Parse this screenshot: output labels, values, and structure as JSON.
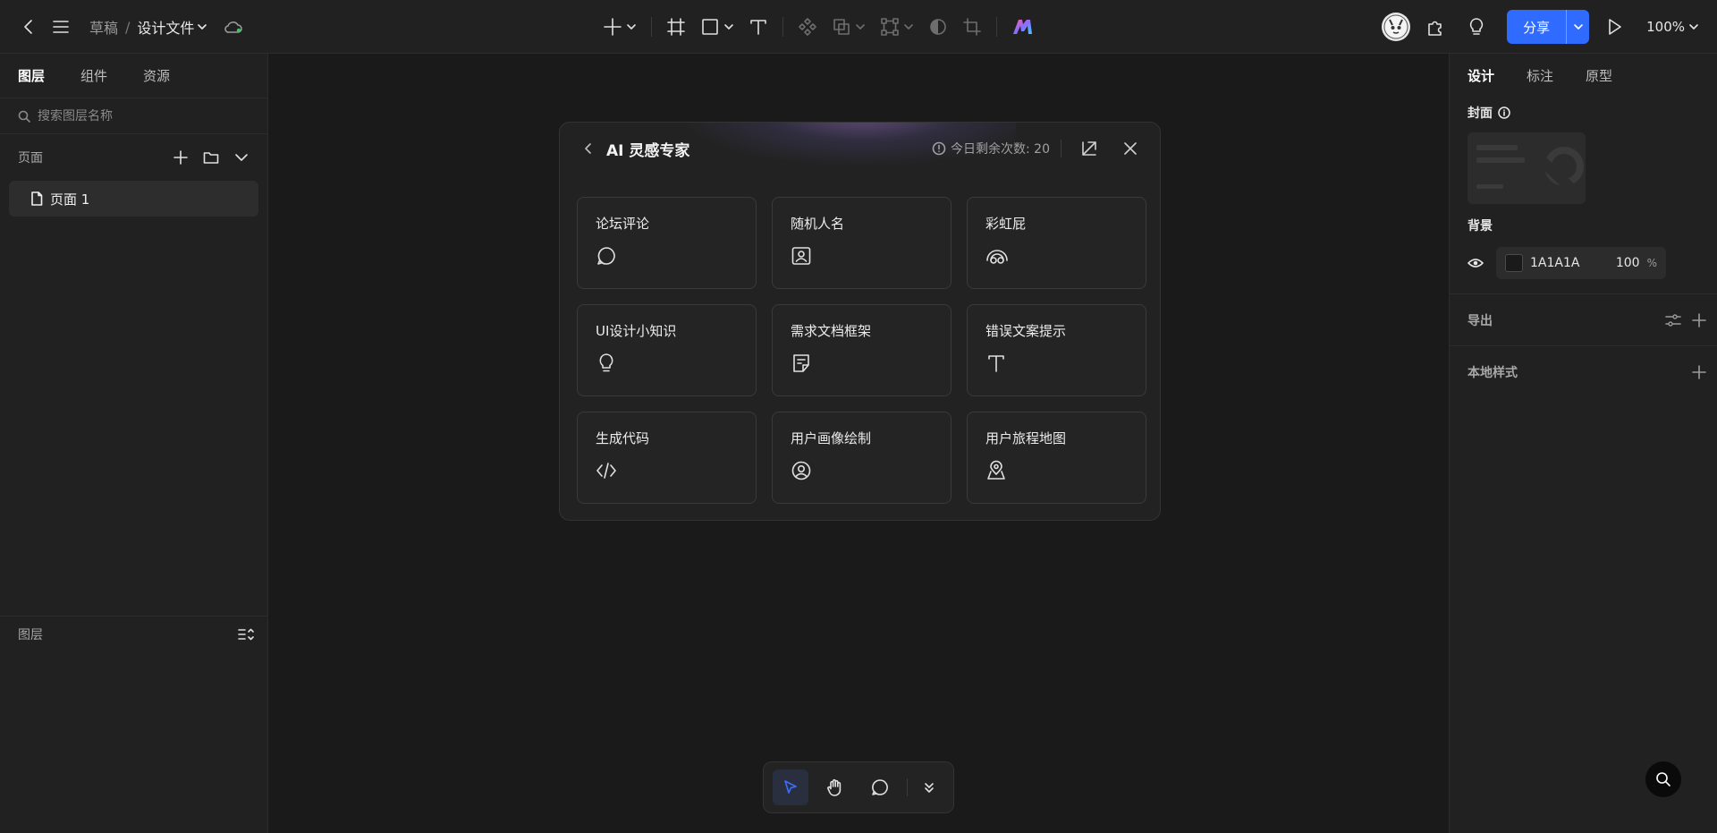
{
  "topbar": {
    "breadcrumb_root": "草稿",
    "breadcrumb_sep": "/",
    "file_name": "设计文件",
    "share_label": "分享",
    "zoom": "100%"
  },
  "left_panel": {
    "tabs": [
      {
        "label": "图层"
      },
      {
        "label": "组件"
      },
      {
        "label": "资源"
      }
    ],
    "search_placeholder": "搜索图层名称",
    "pages_title": "页面",
    "pages": [
      {
        "label": "页面 1"
      }
    ],
    "layers_title": "图层"
  },
  "right_panel": {
    "tabs": [
      {
        "label": "设计"
      },
      {
        "label": "标注"
      },
      {
        "label": "原型"
      }
    ],
    "cover_label": "封面",
    "background_label": "背景",
    "background_hex": "1A1A1A",
    "background_opacity": "100",
    "background_pct": "%",
    "export_label": "导出",
    "local_styles_label": "本地样式"
  },
  "dialog": {
    "title": "AI 灵感专家",
    "quota": "今日剩余次数: 20",
    "cards": [
      {
        "title": "论坛评论",
        "icon": "chat-bubble-icon"
      },
      {
        "title": "随机人名",
        "icon": "contact-card-icon"
      },
      {
        "title": "彩虹屁",
        "icon": "rainbow-icon"
      },
      {
        "title": "UI设计小知识",
        "icon": "lightbulb-icon"
      },
      {
        "title": "需求文档框架",
        "icon": "note-icon"
      },
      {
        "title": "错误文案提示",
        "icon": "text-icon"
      },
      {
        "title": "生成代码",
        "icon": "code-icon"
      },
      {
        "title": "用户画像绘制",
        "icon": "user-circle-icon"
      },
      {
        "title": "用户旅程地图",
        "icon": "map-pin-icon"
      }
    ]
  },
  "colors": {
    "accent": "#2f6bff",
    "canvas": "#1a1a1a",
    "panel": "#212121"
  }
}
